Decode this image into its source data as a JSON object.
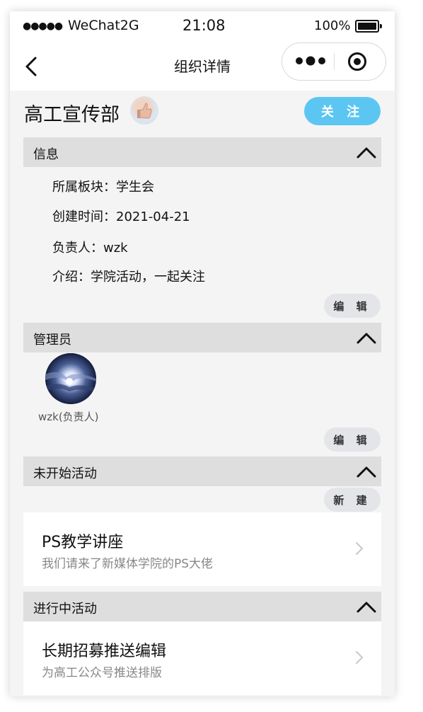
{
  "status_bar": {
    "signal": "●●●●●",
    "carrier": "WeChat2G",
    "time": "21:08",
    "battery": "100%"
  },
  "nav": {
    "title": "组织详情",
    "icons": [
      "back-chevron-icon",
      "more-dots-icon",
      "target-icon"
    ]
  },
  "org": {
    "name": "高工宣传部",
    "follow_label": "关 注"
  },
  "info_section": {
    "title": "信息",
    "lines": [
      "所属板块：学生会",
      "创建时间：2021-04-21",
      "负责人：wzk",
      "介绍：学院活动，一起关注"
    ],
    "edit_label": "编 辑"
  },
  "admin_section": {
    "title": "管理员",
    "admin_name": "wzk(负责人)",
    "edit_label": "编 辑"
  },
  "upcoming_section": {
    "title": "未开始活动",
    "new_label": "新 建",
    "items": [
      {
        "title": "PS教学讲座",
        "subtitle": "我们请来了新媒体学院的PS大佬"
      }
    ]
  },
  "ongoing_section": {
    "title": "进行中活动",
    "items": [
      {
        "title": "长期招募推送编辑",
        "subtitle": "为高工公众号推送排版"
      }
    ]
  },
  "colors": {
    "accent": "#5cc6f2",
    "section_bg": "#dedede",
    "page_bg": "#f4f4f4"
  }
}
